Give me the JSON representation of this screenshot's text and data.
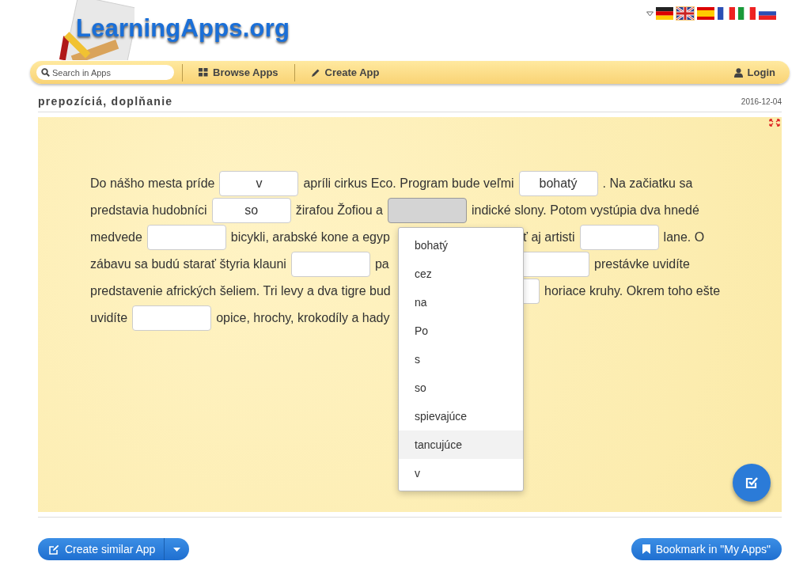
{
  "header": {
    "logo_text": "LearningApps.org",
    "flags": [
      {
        "kind": "de",
        "selected": false
      },
      {
        "kind": "gb",
        "selected": true
      },
      {
        "kind": "es",
        "selected": false
      },
      {
        "kind": "fr",
        "selected": false
      },
      {
        "kind": "it",
        "selected": false
      },
      {
        "kind": "ru",
        "selected": false
      }
    ]
  },
  "navbar": {
    "search": {
      "placeholder": "Search in Apps"
    },
    "browse": "Browse Apps",
    "create": "Create App",
    "login": "Login"
  },
  "app": {
    "title": "prepozíciá, doplňanie",
    "date": "2016-12-04"
  },
  "exercise": {
    "rows": [
      {
        "left": [
          {
            "kind": "text",
            "text": "Do nášho mesta príde"
          },
          {
            "kind": "blank",
            "value": "v",
            "active": false
          },
          {
            "kind": "text",
            "text": "apríli cirkus Eco. Program bude veľmi"
          },
          {
            "kind": "blank",
            "value": "bohatý",
            "active": false
          },
          {
            "kind": "text",
            "text": ". Na začiatku sa"
          }
        ]
      },
      {
        "left": [
          {
            "kind": "text",
            "text": "predstavia hudobníci"
          },
          {
            "kind": "blank",
            "value": "so",
            "active": false
          },
          {
            "kind": "text",
            "text": "žirafou Žofiou a"
          },
          {
            "kind": "blank",
            "active": true
          },
          {
            "kind": "text",
            "text": "indické slony. Potom vystúpia dva hnedé"
          }
        ]
      },
      {
        "left": [
          {
            "kind": "text",
            "text": "medvede"
          },
          {
            "kind": "blank",
            "active": false
          },
          {
            "kind": "text",
            "text": "bicykli, arabské kone a egyp"
          }
        ],
        "right": [
          {
            "kind": "text",
            "text": "ť aj artisti"
          },
          {
            "kind": "blank",
            "active": false
          },
          {
            "kind": "text",
            "text": "lane. O"
          }
        ]
      },
      {
        "left": [
          {
            "kind": "text",
            "text": "zábavu sa budú starať štyria klauni"
          },
          {
            "kind": "blank",
            "active": false
          },
          {
            "kind": "text",
            "text": "pa"
          }
        ],
        "right": [
          {
            "kind": "blank_cut_wide",
            "active": false
          },
          {
            "kind": "text",
            "text": "prestávke uvidíte"
          }
        ]
      },
      {
        "left": [
          {
            "kind": "text",
            "text": "predstavenie afrických šeliem. Tri levy a dva tigre bud"
          }
        ],
        "right": [
          {
            "kind": "blank_cut_narrow",
            "active": false
          },
          {
            "kind": "text",
            "text": "horiace kruhy. Okrem toho ešte"
          }
        ]
      },
      {
        "left": [
          {
            "kind": "text",
            "text": "uvidíte"
          },
          {
            "kind": "blank",
            "active": false
          },
          {
            "kind": "text",
            "text": "opice, hrochy, krokodíly a hady"
          }
        ]
      }
    ],
    "dropdown": [
      {
        "label": "bohatý",
        "selected": false
      },
      {
        "label": "cez",
        "selected": false
      },
      {
        "label": "na",
        "selected": false
      },
      {
        "label": "Po",
        "selected": false
      },
      {
        "label": "s",
        "selected": false
      },
      {
        "label": "so",
        "selected": false
      },
      {
        "label": "spievajúce",
        "selected": false
      },
      {
        "label": "tancujúce",
        "selected": true
      },
      {
        "label": "v",
        "selected": false
      }
    ]
  },
  "footer": {
    "create_similar": "Create similar App",
    "bookmark": "Bookmark in \"My Apps\""
  }
}
